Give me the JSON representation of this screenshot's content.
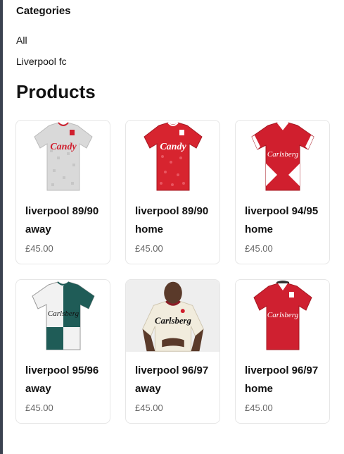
{
  "categories": {
    "title": "Categories",
    "items": [
      "All",
      "Liverpool fc"
    ]
  },
  "products_title": "Products",
  "products": [
    {
      "name": "liverpool 89/90 away",
      "price": "£45.00",
      "icon": "shirt-grey-candy"
    },
    {
      "name": "liverpool 89/90 home",
      "price": "£45.00",
      "icon": "shirt-red-candy"
    },
    {
      "name": "liverpool 94/95 home",
      "price": "£45.00",
      "icon": "shirt-red-carlsberg-white-chevrons"
    },
    {
      "name": "liverpool 95/96 away",
      "price": "£45.00",
      "icon": "shirt-green-white-carlsberg"
    },
    {
      "name": "liverpool 96/97 away",
      "price": "£45.00",
      "icon": "shirt-cream-carlsberg-on-model"
    },
    {
      "name": "liverpool 96/97 home",
      "price": "£45.00",
      "icon": "shirt-red-carlsberg"
    }
  ],
  "colors": {
    "sidebar_bar": "#3b4250",
    "card_border": "#e6e6e6",
    "price": "#666666",
    "liverpool_red": "#d01f2e",
    "away_grey": "#d9d9d9",
    "away_green": "#1f5c57",
    "cream": "#f1ecdd"
  }
}
